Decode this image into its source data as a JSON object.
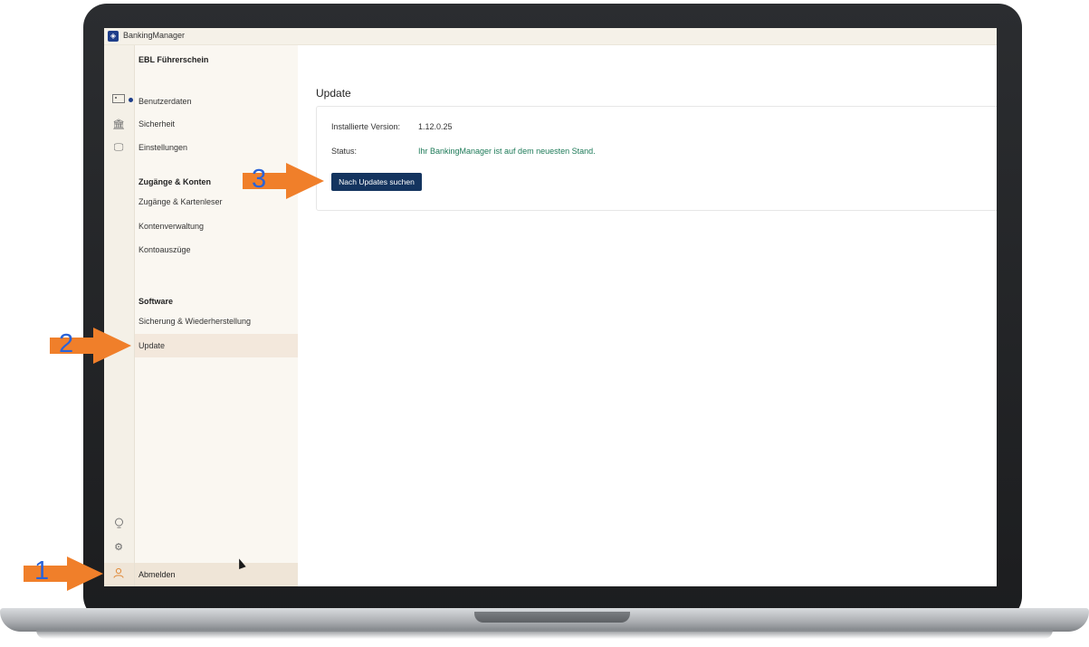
{
  "app": {
    "title": "BankingManager"
  },
  "sidebar": {
    "profile_heading": "EBL Führerschein",
    "profile_items": [
      "Benutzerdaten",
      "Sicherheit",
      "Einstellungen"
    ],
    "accounts_heading": "Zugänge & Konten",
    "accounts_items": [
      "Zugänge & Kartenleser",
      "Kontenverwaltung",
      "Kontoauszüge"
    ],
    "software_heading": "Software",
    "software_items": [
      "Sicherung & Wiederherstellung",
      "Update"
    ],
    "logout_label": "Abmelden"
  },
  "rail_icons": [
    "id-card-icon",
    "bank-icon",
    "monitor-icon",
    "lightbulb-icon",
    "settings-icon",
    "user-icon"
  ],
  "main": {
    "page_title": "Update",
    "installed_version_label": "Installierte Version:",
    "installed_version_value": "1.12.0.25",
    "status_label": "Status:",
    "status_value": "Ihr BankingManager ist auf dem neuesten Stand.",
    "check_button": "Nach Updates suchen"
  },
  "callouts": [
    "1",
    "2",
    "3"
  ],
  "colors": {
    "accent": "#14345f",
    "status_ok": "#1d7a58",
    "callout_arrow": "#f07f2a",
    "callout_number": "#2a63d8"
  }
}
